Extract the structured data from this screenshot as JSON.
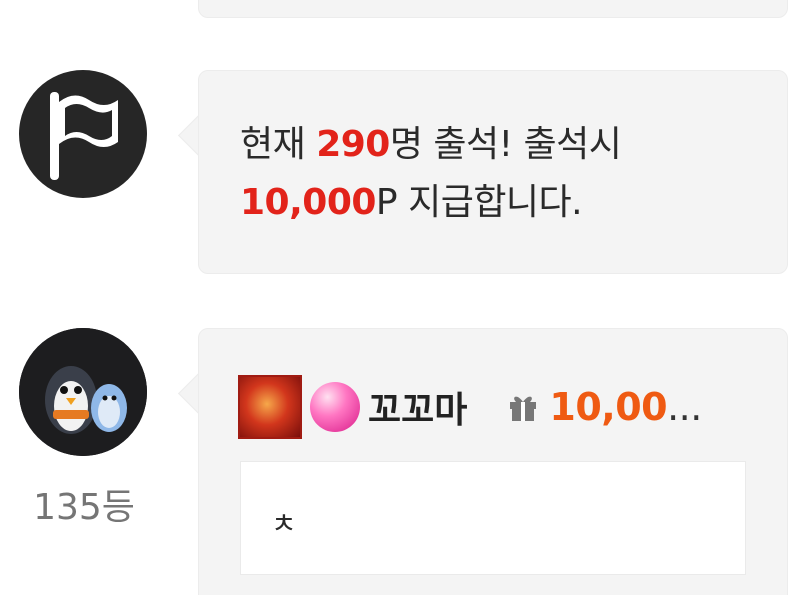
{
  "notice": {
    "icon": "flag-icon",
    "line1_prefix": "현재 ",
    "attendee_count": "290",
    "line1_suffix": "명 출석! 출석시",
    "reward_points": "10,000",
    "line2_suffix": "P 지급합니다."
  },
  "chat": {
    "rank": "135등",
    "badges": [
      "dragon-badge-icon",
      "candy-badge-icon"
    ],
    "nickname": "꼬꼬마",
    "gift_icon": "gift-icon",
    "gift_amount": "10,00",
    "gift_amount_ellipsis": "...",
    "message": "ㅊ"
  },
  "colors": {
    "highlight_red": "#e2231a",
    "gift_orange": "#ef5a12",
    "bubble_bg": "#f4f4f4"
  }
}
